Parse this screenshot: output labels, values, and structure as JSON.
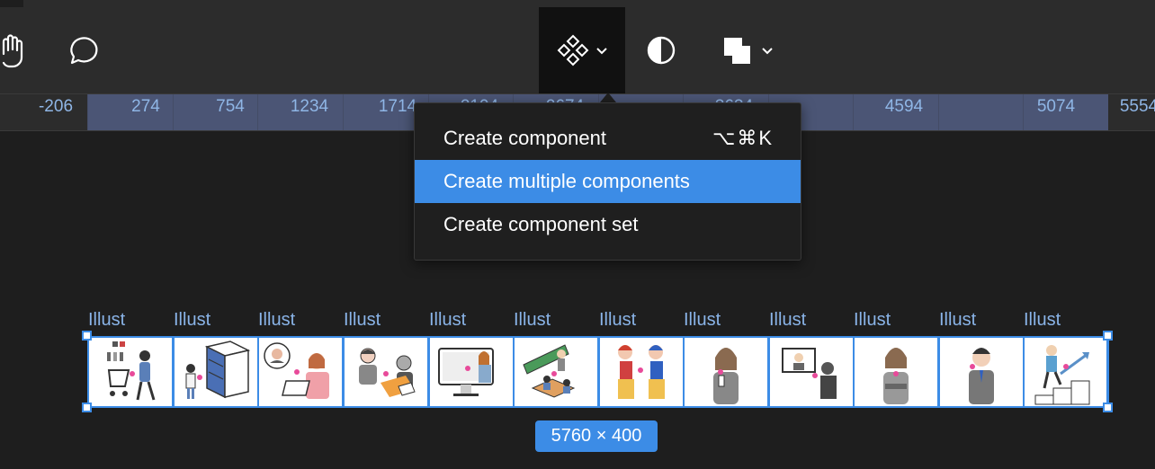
{
  "toolbar": {
    "tools": [
      {
        "name": "hand-tool",
        "icon": "hand-icon"
      },
      {
        "name": "comment-tool",
        "icon": "speech-bubble-icon"
      },
      {
        "name": "component-tool",
        "icon": "component-diamond-icon",
        "active": true
      },
      {
        "name": "mask-tool",
        "icon": "half-circle-icon"
      },
      {
        "name": "boolean-tool",
        "icon": "overlap-squares-icon"
      }
    ]
  },
  "ruler": {
    "labels": [
      "-206",
      "274",
      "754",
      "1234",
      "1714",
      "2194",
      "2674",
      "3634",
      "4594",
      "5074",
      "5554"
    ]
  },
  "component_menu": {
    "items": [
      {
        "label": "Create component",
        "shortcut": "⌥⌘K",
        "highlighted": false
      },
      {
        "label": "Create multiple components",
        "shortcut": "",
        "highlighted": true
      },
      {
        "label": "Create component set",
        "shortcut": "",
        "highlighted": false
      }
    ]
  },
  "canvas": {
    "frames": [
      {
        "label": "Illust",
        "icon": "shopping-cart-illustration"
      },
      {
        "label": "Illust",
        "icon": "drawer-cabinet-illustration"
      },
      {
        "label": "Illust",
        "icon": "laptop-worker-illustration"
      },
      {
        "label": "Illust",
        "icon": "meeting-illustration"
      },
      {
        "label": "Illust",
        "icon": "monitor-presenter-illustration"
      },
      {
        "label": "Illust",
        "icon": "classroom-illustration"
      },
      {
        "label": "Illust",
        "icon": "two-kids-illustration"
      },
      {
        "label": "Illust",
        "icon": "woman-phone-illustration"
      },
      {
        "label": "Illust",
        "icon": "video-call-illustration"
      },
      {
        "label": "Illust",
        "icon": "woman-arms-crossed-illustration"
      },
      {
        "label": "Illust",
        "icon": "businessman-illustration"
      },
      {
        "label": "Illust",
        "icon": "growth-stairs-illustration"
      }
    ],
    "selection_size": "5760 × 400"
  },
  "colors": {
    "accent": "#3c8ce6",
    "toolbar_bg": "#2c2c2c",
    "canvas_bg": "#1e1e1e",
    "menu_bg": "#1f1f1f"
  }
}
